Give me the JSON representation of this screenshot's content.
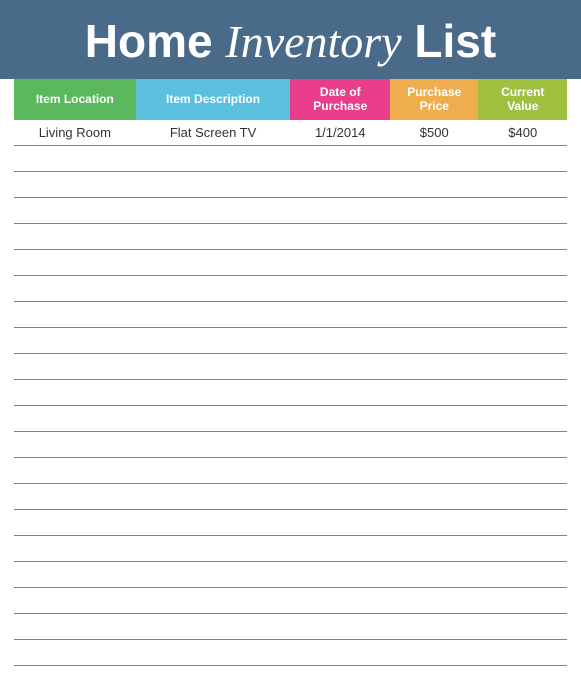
{
  "header": {
    "title_part1": "Home",
    "title_part2": "Inventory",
    "title_part3": "List"
  },
  "columns": {
    "location": "Item Location",
    "description": "Item Description",
    "date": "Date of Purchase",
    "price": "Purchase Price",
    "value": "Current Value"
  },
  "rows": [
    {
      "location": "Living Room",
      "description": "Flat Screen TV",
      "date": "1/1/2014",
      "price": "$500",
      "value": "$400"
    }
  ],
  "empty_row_count": 20
}
